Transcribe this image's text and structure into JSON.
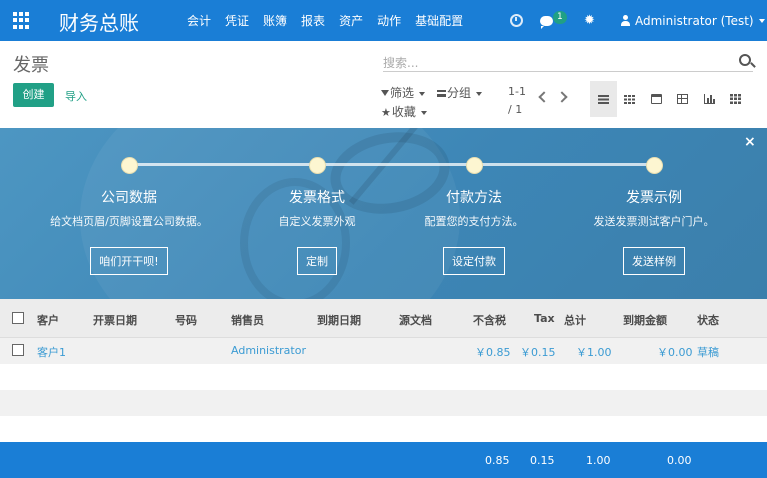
{
  "app": {
    "name": "财务总账",
    "menu": [
      "会计",
      "凭证",
      "账簿",
      "报表",
      "资产",
      "动作",
      "基础配置"
    ],
    "chat_badge": "1",
    "user": "Administrator (Test)"
  },
  "control_panel": {
    "title": "发票",
    "create_label": "创建",
    "import_label": "导入",
    "search_placeholder": "搜索...",
    "filter_label": "筛选",
    "groupby_label": "分组",
    "favorites_label": "收藏",
    "pager_range": "1-1",
    "pager_total": "/ 1",
    "views": [
      "list-view",
      "kanban-view",
      "calendar-view",
      "pivot-view",
      "graph-view",
      "grid-view"
    ]
  },
  "onboarding": {
    "close": "×",
    "steps": [
      {
        "title": "公司数据",
        "desc": "给文档页眉/页脚设置公司数据。",
        "button": "咱们开干呗!"
      },
      {
        "title": "发票格式",
        "desc": "自定义发票外观",
        "button": "定制"
      },
      {
        "title": "付款方法",
        "desc": "配置您的支付方法。",
        "button": "设定付款"
      },
      {
        "title": "发票示例",
        "desc": "发送发票测试客户门户。",
        "button": "发送样例"
      }
    ]
  },
  "table": {
    "columns": [
      "客户",
      "开票日期",
      "号码",
      "销售员",
      "到期日期",
      "源文档",
      "不含税",
      "Tax",
      "总计",
      "到期金额",
      "状态"
    ],
    "rows": [
      {
        "customer": "客户1",
        "invoice_date": "",
        "number": "",
        "salesperson": "Administrator",
        "due_date": "",
        "source": "",
        "untaxed": "￥0.85",
        "tax": "￥0.15",
        "total": "￥1.00",
        "amount_due": "￥0.00",
        "state": "草稿"
      }
    ],
    "totals": {
      "untaxed": "0.85",
      "tax": "0.15",
      "total": "1.00",
      "amount_due": "0.00"
    }
  }
}
